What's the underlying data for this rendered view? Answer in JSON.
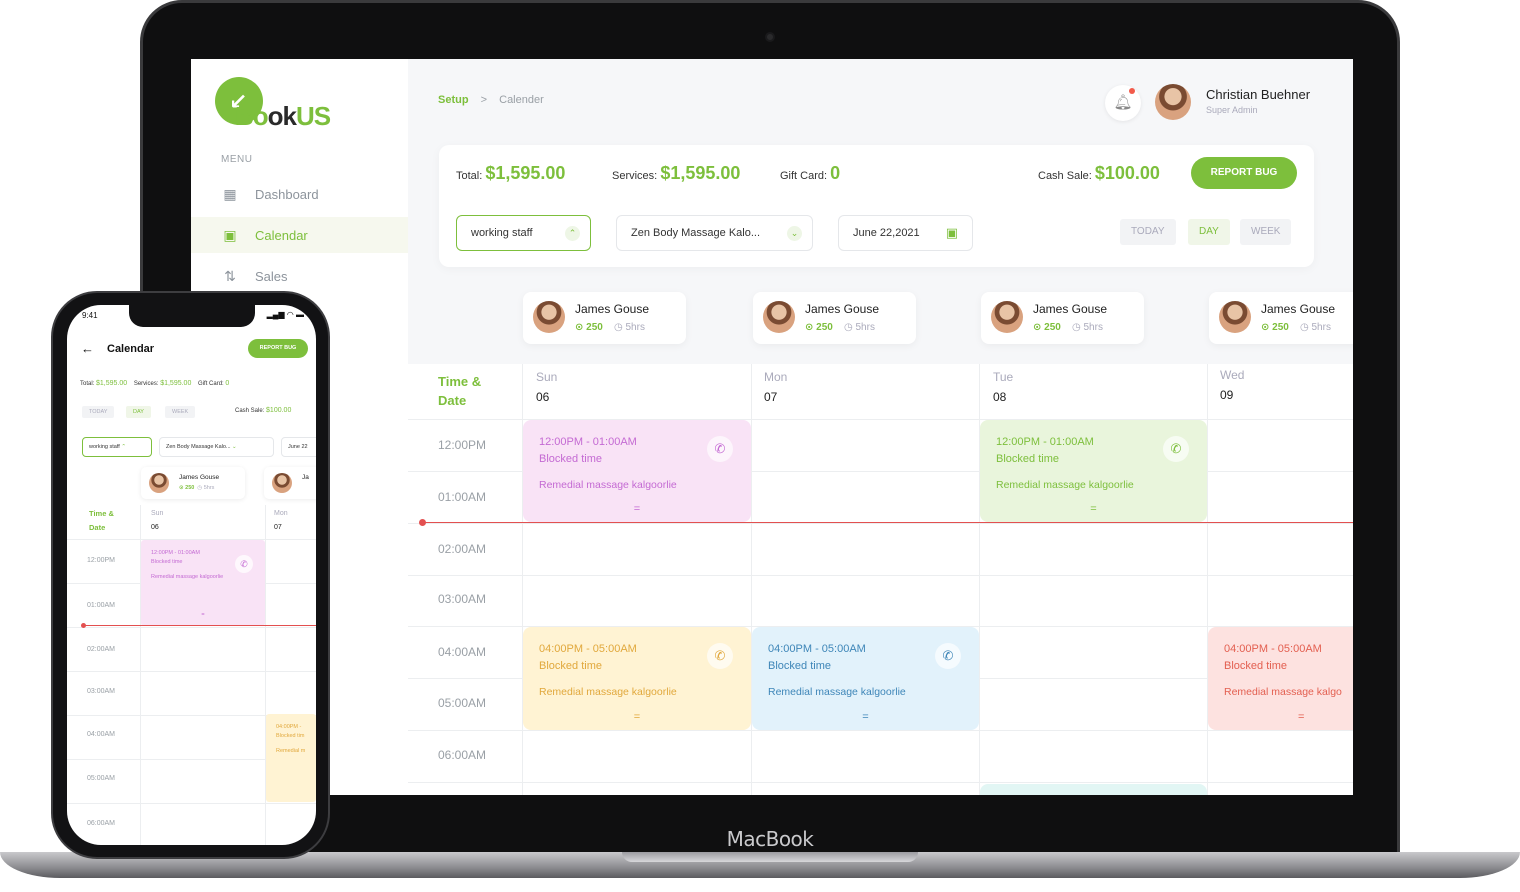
{
  "device": {
    "laptop_brand": "MacBook"
  },
  "logo": {
    "text_pre": "Bo",
    "text_mid": "ok",
    "text_post": "US"
  },
  "sidebar": {
    "menu_label": "MENU",
    "items": [
      {
        "label": "Dashboard",
        "icon": "grid-icon",
        "active": false
      },
      {
        "label": "Calendar",
        "icon": "calendar-icon",
        "active": true
      },
      {
        "label": "Sales",
        "icon": "sort-arrows-icon",
        "active": false
      }
    ]
  },
  "header": {
    "breadcrumb": {
      "root": "Setup",
      "separator": ">",
      "current": "Calender"
    },
    "user": {
      "name": "Christian Buehner",
      "role": "Super Admin"
    }
  },
  "stats": {
    "total_label": "Total:",
    "total_value": "$1,595.00",
    "services_label": "Services:",
    "services_value": "$1,595.00",
    "giftcard_label": "Gift Card:",
    "giftcard_value": "0",
    "cash_label": "Cash Sale:",
    "cash_value": "$100.00",
    "report_button": "REPORT BUG"
  },
  "filters": {
    "staff": "working staff",
    "service": "Zen Body Massage Kalo...",
    "date": "June 22,2021",
    "views": [
      "TODAY",
      "DAY",
      "WEEK"
    ],
    "active_view": "DAY"
  },
  "staff": [
    {
      "name": "James Gouse",
      "points": "250",
      "hours": "5hrs"
    },
    {
      "name": "James Gouse",
      "points": "250",
      "hours": "5hrs"
    },
    {
      "name": "James Gouse",
      "points": "250",
      "hours": "5hrs"
    },
    {
      "name": "James Gouse",
      "points": "250",
      "hours": "5hrs"
    }
  ],
  "calendar": {
    "time_header_line1": "Time &",
    "time_header_line2": "Date",
    "days": [
      {
        "name": "Sun",
        "date": "06"
      },
      {
        "name": "Mon",
        "date": "07"
      },
      {
        "name": "Tue",
        "date": "08"
      },
      {
        "name": "Wed",
        "date": "09"
      }
    ],
    "times": [
      "12:00PM",
      "01:00AM",
      "02:00AM",
      "03:00AM",
      "04:00AM",
      "05:00AM",
      "06:00AM"
    ],
    "events": [
      {
        "time": "12:00PM - 01:00AM",
        "status": "Blocked time",
        "service": "Remedial massage kalgoorlie",
        "color": "#c46ad3"
      },
      {
        "time": "12:00PM - 01:00AM",
        "status": "Blocked time",
        "service": "Remedial massage kalgoorlie",
        "color": "#7dbf3c"
      },
      {
        "time": "04:00PM - 05:00AM",
        "status": "Blocked time",
        "service": "Remedial massage kalgoorlie",
        "color": "#e1a83c"
      },
      {
        "time": "04:00PM - 05:00AM",
        "status": "Blocked time",
        "service": "Remedial massage kalgoorlie",
        "color": "#3e86b8"
      },
      {
        "time": "04:00PM - 05:00AM",
        "status": "Blocked time",
        "service": "Remedial massage kalgo",
        "color": "#e35f50"
      }
    ]
  },
  "phone": {
    "clock": "9:41",
    "title": "Calendar",
    "report_button": "REPORT BUG",
    "total_label": "Total:",
    "total_value": "$1,595.00",
    "services_label": "Services:",
    "services_value": "$1,595.00",
    "giftcard_label": "Gift Card:",
    "giftcard_value": "0",
    "cash_label": "Cash Sale:",
    "cash_value": "$100.00",
    "views": [
      "TODAY",
      "DAY",
      "WEEK"
    ],
    "staff_select": "working staff",
    "service_select": "Zen Body Massage Kalo...",
    "date_select": "June 22",
    "staff_name": "James Gouse",
    "staff_name_clipped": "Ja",
    "staff_points": "250",
    "staff_hours": "5hrs",
    "days": [
      {
        "name": "Sun",
        "date": "06"
      },
      {
        "name": "Mon",
        "date": "07"
      }
    ],
    "times": [
      "12:00PM",
      "01:00AM",
      "02:00AM",
      "03:00AM",
      "04:00AM",
      "05:00AM",
      "06:00AM"
    ],
    "event1": {
      "time": "12:00PM - 01:00AM",
      "status": "Blocked time",
      "service": "Remedial massage kalgoorlie"
    },
    "event2": {
      "time": "04:00PM -",
      "status": "Blocked tim",
      "service": "Remedial m"
    }
  }
}
